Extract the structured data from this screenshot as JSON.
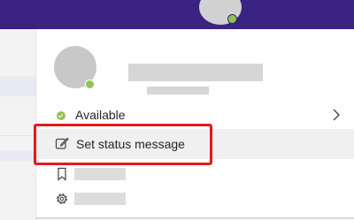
{
  "header": {
    "avatar_icon": "user-avatar-icon",
    "presence_color": "#92c353",
    "bar_color": "#3b2381"
  },
  "profile": {
    "avatar_icon": "user-avatar-icon",
    "presence_color": "#92c353"
  },
  "menu": {
    "presence": {
      "label": "Available",
      "status_icon": "available-check-icon",
      "chevron_icon": "chevron-right-icon"
    },
    "status_message": {
      "label": "Set status message",
      "icon": "edit-icon",
      "highlighted": true,
      "highlight_color": "#e51a1a"
    },
    "saved": {
      "icon": "bookmark-icon"
    },
    "settings": {
      "icon": "gear-icon"
    }
  }
}
